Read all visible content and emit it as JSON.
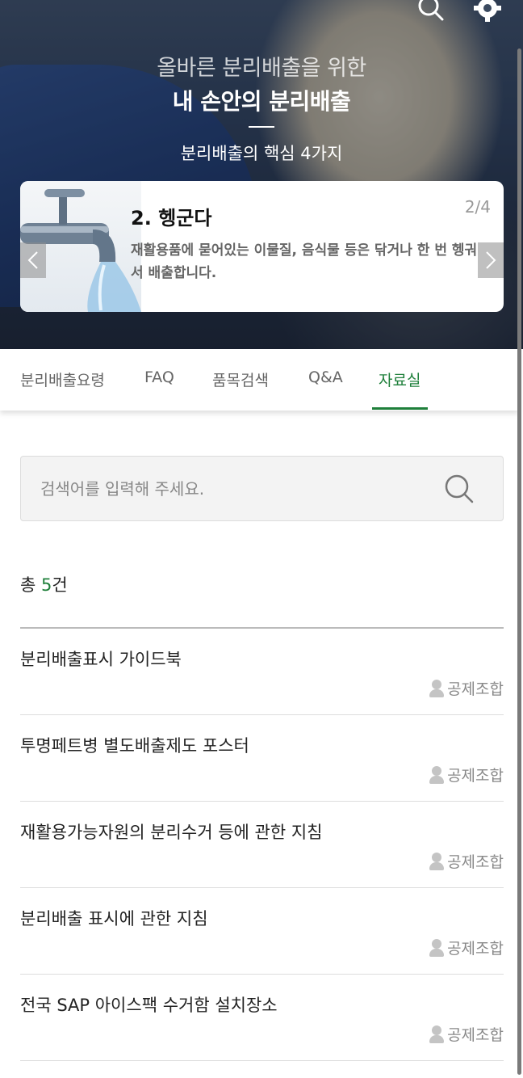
{
  "header": {
    "subtitle": "올바른 분리배출을 위한",
    "title": "내 손안의 분리배출",
    "caption": "분리배출의 핵심 4가지"
  },
  "slide": {
    "number": "2.",
    "title": "헹군다",
    "page": "2/4",
    "description": "재활용품에 묻어있는 이물질, 음식물 등은 닦거나 한 번 헹궈서 배출합니다."
  },
  "tabs": [
    {
      "label": "분리배출요령"
    },
    {
      "label": "FAQ"
    },
    {
      "label": "품목검색"
    },
    {
      "label": "Q&A"
    },
    {
      "label": "자료실"
    }
  ],
  "active_tab": "자료실",
  "search": {
    "placeholder": "검색어를 입력해 주세요."
  },
  "summary": {
    "prefix": "총 ",
    "count": "5",
    "suffix": "건"
  },
  "list": [
    {
      "title": "분리배출표시 가이드북",
      "author": "공제조합"
    },
    {
      "title": "투명페트병 별도배출제도 포스터",
      "author": "공제조합"
    },
    {
      "title": "재활용가능자원의 분리수거 등에 관한 지침",
      "author": "공제조합"
    },
    {
      "title": "분리배출 표시에 관한 지침",
      "author": "공제조합"
    },
    {
      "title": "전국 SAP 아이스팩 수거함 설치장소",
      "author": "공제조합"
    }
  ],
  "colors": {
    "accent": "#1e7f3a",
    "muted_text": "#888888"
  }
}
